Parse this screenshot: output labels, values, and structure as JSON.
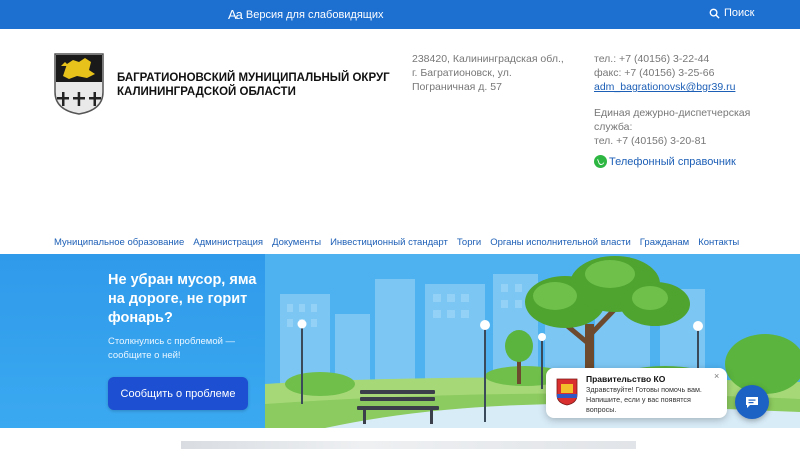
{
  "topbar": {
    "vision_icon_text": "Aa",
    "vision_label": "Версия для слабовидящих",
    "search_label": "Поиск"
  },
  "header": {
    "org_name": "БАГРАТИОНОВСКИЙ МУНИЦИПАЛЬНЫЙ ОКРУГ КАЛИНИНГРАДСКОЙ ОБЛАСТИ",
    "address": "238420, Калининградская обл., г. Багратионовск, ул. Пограничная д. 57",
    "phone": "тел.:   +7 (40156) 3-22-44",
    "fax": "факс: +7 (40156) 3-25-66",
    "email": "adm_bagrationovsk@bgr39.ru",
    "duty_label": "Единая дежурно-диспетчерская служба:",
    "duty_phone": "тел. +7 (40156) 3-20-81",
    "phonebook_label": "Телефонный справочник"
  },
  "nav": {
    "items": [
      "Муниципальное образование",
      "Администрация",
      "Документы",
      "Инвестиционный стандарт",
      "Торги",
      "Органы исполнительной власти",
      "Гражданам",
      "Контакты"
    ]
  },
  "banner": {
    "title": "Не убран мусор, яма на дороге, не горит фонарь?",
    "subtitle": "Столкнулись с проблемой — сообщите о ней!",
    "button_label": "Сообщить о проблеме"
  },
  "chat": {
    "title": "Правительство КО",
    "message": "Здравствуйте! Готовы помочь вам. Напишите, если у вас появятся вопросы.",
    "close_symbol": "×"
  },
  "colors": {
    "topbar": "#1d6fd0",
    "link": "#1d5fb6",
    "button": "#1c4fd1",
    "banner": "#38a5ef"
  }
}
